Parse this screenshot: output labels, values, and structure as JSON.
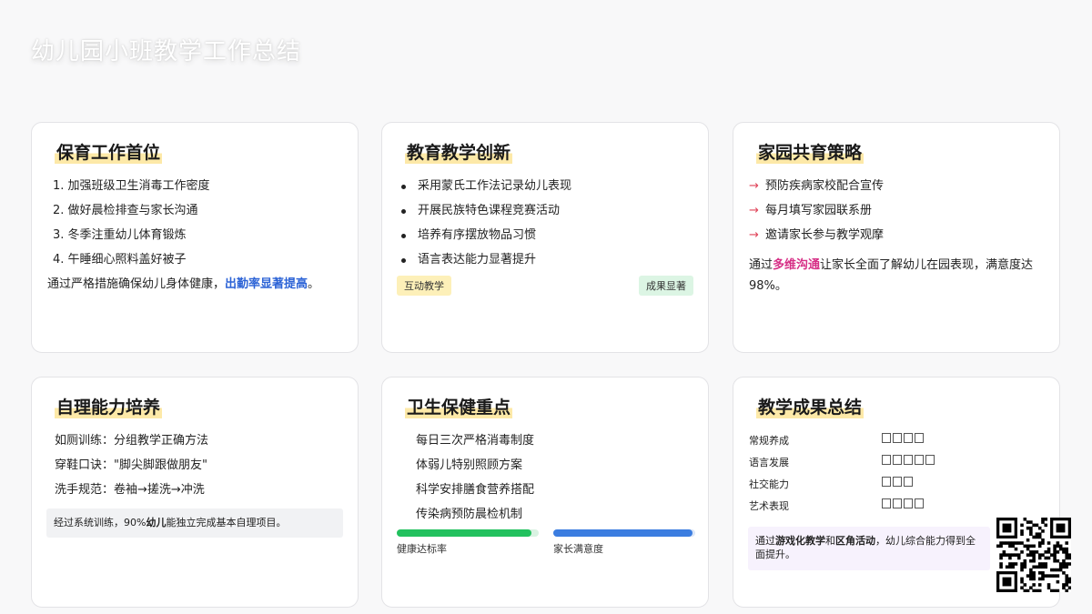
{
  "title": "幼儿园小班教学工作总结",
  "cards": {
    "care": {
      "title": "保育工作首位",
      "items": [
        "1. 加强班级卫生消毒工作密度",
        "2. 做好晨检排查与家长沟通",
        "3. 冬季注重幼儿体育锻炼",
        "4. 午睡细心照料盖好被子"
      ],
      "note_prefix": "通过严格措施确保幼儿身体健康，",
      "note_highlight": "出勤率显著提高",
      "note_suffix": "。"
    },
    "teaching": {
      "title": "教育教学创新",
      "items": [
        "采用蒙氏工作法记录幼儿表现",
        "开展民族特色课程竞赛活动",
        "培养有序摆放物品习惯",
        "语言表达能力显著提升"
      ],
      "tag_left": "互动教学",
      "tag_right": "成果显著"
    },
    "home": {
      "title": "家园共育策略",
      "items": [
        "预防疾病家校配合宣传",
        "每月填写家园联系册",
        "邀请家长参与教学观摩"
      ],
      "arrow": "→",
      "note_prefix": "通过",
      "note_highlight": "多维沟通",
      "note_suffix": "让家长全面了解幼儿在园表现，满意度达98%。"
    },
    "selfcare": {
      "title": "自理能力培养",
      "items": [
        "如厕训练：分组教学正确方法",
        "穿鞋口诀：\"脚尖脚跟做朋友\"",
        "洗手规范：卷袖→搓洗→冲洗"
      ],
      "box_prefix": "经过系统训练，90%",
      "box_highlight": "幼儿",
      "box_suffix": "能独立完成基本自理项目。"
    },
    "health": {
      "title": "卫生保健重点",
      "items": [
        "每日三次严格消毒制度",
        "体弱儿特别照顾方案",
        "科学安排膳食营养搭配",
        "传染病预防晨检机制"
      ],
      "bars": [
        {
          "label": "健康达标率",
          "value": 0.95,
          "color": "#22c15e"
        },
        {
          "label": "家长满意度",
          "value": 0.98,
          "color": "#3b7de0"
        }
      ]
    },
    "results": {
      "title": "教学成果总结",
      "rows": [
        {
          "label": "常规养成",
          "stars": 4
        },
        {
          "label": "语言发展",
          "stars": 5
        },
        {
          "label": "社交能力",
          "stars": 3
        },
        {
          "label": "艺术表现",
          "stars": 4
        }
      ],
      "box_prefix": "通过",
      "box_h1": "游戏化教学",
      "box_mid": "和",
      "box_h2": "区角活动",
      "box_suffix": "，幼儿综合能力得到全面提升。"
    }
  },
  "qr_icon": "qr-code-icon"
}
